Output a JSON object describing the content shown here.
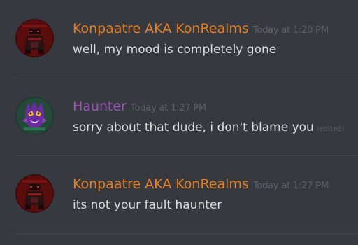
{
  "colors": {
    "background": "#36393f",
    "konpaatre_name": "#e67e22",
    "haunter_name": "#9b59b6",
    "message_text": "#dcddde",
    "muted": "#5d6064"
  },
  "messages": [
    {
      "author": "Konpaatre AKA KonRealms",
      "timestamp": "Today at 1:20 PM",
      "text": "well, my mood is completely gone",
      "edited": "",
      "avatar_icon": "konpaatre-avatar-icon",
      "name_color": "#e67e22"
    },
    {
      "author": "Haunter",
      "timestamp": "Today at 1:27 PM",
      "text": "sorry about that dude, i don't blame you",
      "edited": "(edited)",
      "avatar_icon": "haunter-avatar-icon",
      "name_color": "#9b59b6"
    },
    {
      "author": "Konpaatre AKA KonRealms",
      "timestamp": "Today at 1:27 PM",
      "text": "its not your fault haunter",
      "edited": "",
      "avatar_icon": "konpaatre-avatar-icon",
      "name_color": "#e67e22"
    }
  ]
}
